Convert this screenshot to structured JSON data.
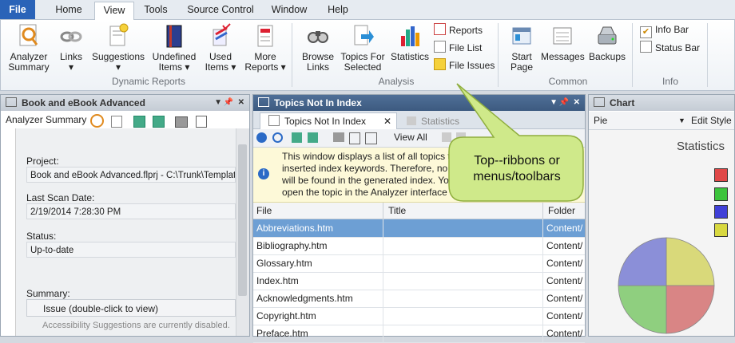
{
  "tabs": [
    {
      "label": "File"
    },
    {
      "label": "Home"
    },
    {
      "label": "View"
    },
    {
      "label": "Tools"
    },
    {
      "label": "Source Control"
    },
    {
      "label": "Window"
    },
    {
      "label": "Help"
    }
  ],
  "ribbon": {
    "dynamic": {
      "label": "Dynamic Reports",
      "buttons": [
        {
          "l1": "Analyzer",
          "l2": "Summary"
        },
        {
          "l1": "Links",
          "l2": "▾"
        },
        {
          "l1": "Suggestions",
          "l2": "▾"
        },
        {
          "l1": "Undefined",
          "l2": "Items ▾"
        },
        {
          "l1": "Used",
          "l2": "Items ▾"
        },
        {
          "l1": "More",
          "l2": "Reports ▾"
        }
      ]
    },
    "analysis": {
      "label": "Analysis",
      "buttons": [
        {
          "l1": "Browse",
          "l2": "Links"
        },
        {
          "l1": "Topics For",
          "l2": "Selected"
        },
        {
          "l1": "Statistics",
          "l2": ""
        }
      ],
      "small": [
        "Reports",
        "File List",
        "File Issues"
      ]
    },
    "common": {
      "label": "Common",
      "buttons": [
        {
          "l1": "Start",
          "l2": "Page"
        },
        {
          "l1": "Messages",
          "l2": ""
        },
        {
          "l1": "Backups",
          "l2": ""
        }
      ]
    },
    "info": {
      "label": "Info",
      "checks": [
        {
          "label": "Info Bar",
          "checked": true
        },
        {
          "label": "Status Bar",
          "checked": false
        }
      ]
    }
  },
  "left_pane": {
    "title": "Book and eBook Advanced",
    "toolbar_label": "Analyzer Summary",
    "project_label": "Project:",
    "project_value": "Book and eBook Advanced.flprj - C:\\Trunk\\Templates\\",
    "scan_label": "Last Scan Date:",
    "scan_value": "2/19/2014 7:28:30 PM",
    "status_label": "Status:",
    "status_value": "Up-to-date",
    "summary_label": "Summary:",
    "summary_header": "Issue (double-click to view)",
    "summary_row": "Accessibility Suggestions are currently disabled."
  },
  "mid_pane": {
    "title": "Topics Not In Index",
    "tab_active": "Topics Not In Index",
    "tab_other": "Statistics",
    "view_all": "View All",
    "info_lines": [
      "This window displays a list of all topics t",
      "inserted index keywords. Therefore, no r",
      "will be found in the generated index. Yo",
      "open the topic in the Analyzer interface"
    ],
    "columns": [
      "File",
      "Title",
      "Folder"
    ],
    "rows": [
      {
        "file": "Abbreviations.htm",
        "title": "",
        "folder": "Content/"
      },
      {
        "file": "Bibliography.htm",
        "title": "",
        "folder": "Content/"
      },
      {
        "file": "Glossary.htm",
        "title": "",
        "folder": "Content/"
      },
      {
        "file": "Index.htm",
        "title": "",
        "folder": "Content/"
      },
      {
        "file": "Acknowledgments.htm",
        "title": "",
        "folder": "Content/"
      },
      {
        "file": "Copyright.htm",
        "title": "",
        "folder": "Content/"
      },
      {
        "file": "Preface.htm",
        "title": "",
        "folder": "Content/"
      }
    ]
  },
  "right_pane": {
    "title": "Chart",
    "chart_type": "Pie",
    "edit_style": "Edit Style",
    "chart_title": "Statistics"
  },
  "chart_data": {
    "type": "pie",
    "title": "Statistics",
    "values": [
      25,
      25,
      25,
      25
    ],
    "colors": [
      "#d9d97a",
      "#d98585",
      "#8fcf7f",
      "#8b8fd8"
    ],
    "legend_colors": [
      "#e04848",
      "#3cc43c",
      "#4040d8",
      "#d8d840"
    ]
  },
  "callout": {
    "text": "Top--ribbons or menus/toolbars"
  }
}
